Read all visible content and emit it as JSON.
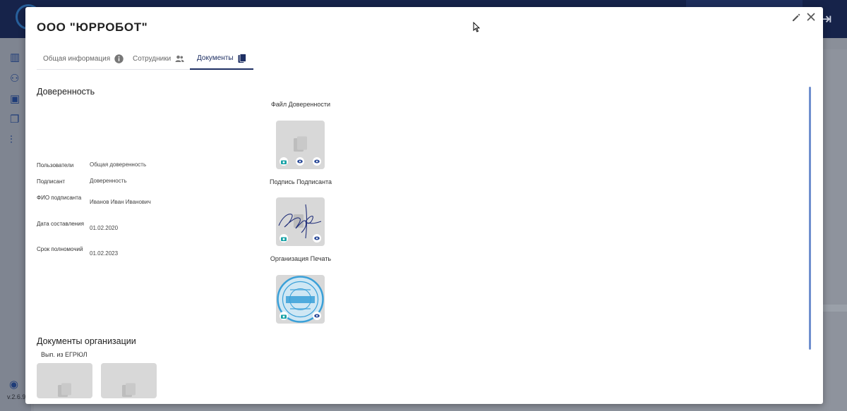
{
  "app": {
    "version": "v.2.6.9"
  },
  "modal": {
    "title": "ООО \"ЮРРОБОТ\"",
    "tabs": [
      {
        "label": "Общая информация",
        "icon": "info-icon"
      },
      {
        "label": "Сотрудники",
        "icon": "people-icon"
      },
      {
        "label": "Документы",
        "icon": "documents-icon",
        "active": true
      }
    ]
  },
  "power_of_attorney": {
    "section_title": "Доверенность",
    "fields": [
      {
        "label": "Пользователи",
        "value": "Общая доверенность"
      },
      {
        "label": "Подписант",
        "value": "Доверенность"
      },
      {
        "label": "ФИО подписанта",
        "value": "Иванов Иван Иванович"
      },
      {
        "label": "Дата составления",
        "value": "01.02.2020"
      },
      {
        "label": "Срок полномочий",
        "value": "01.02.2023"
      }
    ],
    "attachments": [
      {
        "caption": "Файл Доверенности",
        "content": "placeholder-document-icon"
      },
      {
        "caption": "Подпись Подписанта",
        "content": "signature-image"
      },
      {
        "caption": "Организация Печать",
        "content": "stamp-image"
      }
    ]
  },
  "org_documents": {
    "section_title": "Документы организации",
    "sub_caption": "Вып. из ЕГРЮЛ"
  },
  "colors": {
    "accent": "#1e2f63",
    "topbar": "#16234a",
    "scroll": "#6f8fce",
    "stamp": "#3aa0d8",
    "signature": "#22307a"
  }
}
